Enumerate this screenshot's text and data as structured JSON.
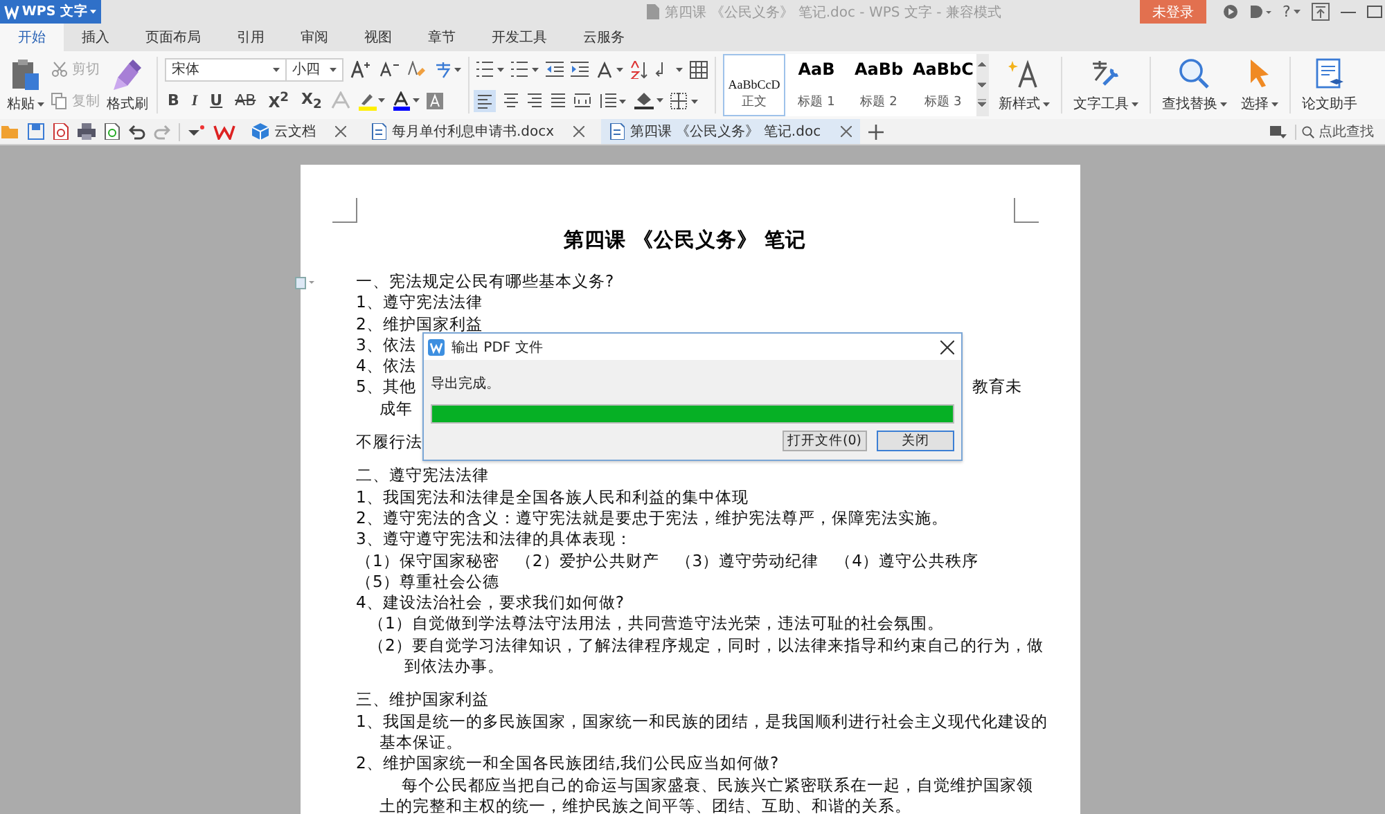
{
  "app_menu": {
    "label": "WPS 文字"
  },
  "window": {
    "title": "第四课 《公民义务》 笔记.doc - WPS 文字 - 兼容模式"
  },
  "login_button": {
    "label": "未登录"
  },
  "help_button": {
    "label": "?"
  },
  "ribbon_tabs": [
    {
      "label": "开始",
      "selected": true
    },
    {
      "label": "插入",
      "selected": false
    },
    {
      "label": "页面布局",
      "selected": false
    },
    {
      "label": "引用",
      "selected": false
    },
    {
      "label": "审阅",
      "selected": false
    },
    {
      "label": "视图",
      "selected": false
    },
    {
      "label": "章节",
      "selected": false
    },
    {
      "label": "开发工具",
      "selected": false
    },
    {
      "label": "云服务",
      "selected": false
    }
  ],
  "ribbon": {
    "paste": {
      "label": "粘贴"
    },
    "cut": {
      "label": "剪切",
      "disabled": true
    },
    "copy": {
      "label": "复制",
      "disabled": true
    },
    "format_painter": {
      "label": "格式刷"
    },
    "font_name": {
      "value": "宋体"
    },
    "font_size": {
      "value": "小四"
    },
    "format_buttons": [
      {
        "label": "B",
        "kind": "bold"
      },
      {
        "label": "I",
        "kind": "italic"
      },
      {
        "label": "U",
        "kind": "underline"
      },
      {
        "label": "AB",
        "kind": "strike"
      },
      {
        "label": "X$^{2}$",
        "kind": "script"
      },
      {
        "label": "X$_{2}$",
        "kind": "script"
      }
    ],
    "styles": [
      {
        "preview": "AaBbCcD",
        "label": "正文",
        "selected": true,
        "kind": "body"
      },
      {
        "preview": "AaB",
        "label": "标题 1",
        "selected": false,
        "kind": "heading"
      },
      {
        "preview": "AaBb",
        "label": "标题 2",
        "selected": false,
        "kind": "heading"
      },
      {
        "preview": "AaBbC",
        "label": "标题 3",
        "selected": false,
        "kind": "heading"
      }
    ],
    "tools": [
      {
        "label": "新样式",
        "kind": "new-style"
      },
      {
        "label": "文字工具",
        "kind": "text-tools"
      },
      {
        "label": "查找替换",
        "kind": "find"
      },
      {
        "label": "选择",
        "kind": "select"
      },
      {
        "label": "论文助手",
        "kind": "paper"
      }
    ]
  },
  "doc_tabs": [
    {
      "label": "云文档",
      "kind": "cloud",
      "selected": false
    },
    {
      "label": "每月单付利息申请书.docx",
      "kind": "doc",
      "selected": false
    },
    {
      "label": "第四课 《公民义务》 笔记.doc",
      "kind": "doc",
      "selected": true
    }
  ],
  "search": {
    "placeholder": "点此查找"
  },
  "document": {
    "title": "第四课 《公民义务》 笔记",
    "sections": [
      {
        "lines": [
          {
            "text": "一、宪法规定公民有哪些基本义务?",
            "kind": "line"
          },
          {
            "text": "1、遵守宪法法律",
            "kind": "line"
          },
          {
            "text": "2、维护国家利益",
            "kind": "line"
          },
          {
            "text": "3、依法",
            "kind": "line"
          },
          {
            "text": "4、依法",
            "kind": "line"
          },
          {
            "text": "5、其他",
            "tail": "教育未",
            "kind": "line"
          },
          {
            "text": "成年",
            "kind": "wrap"
          }
        ]
      },
      {
        "lines": [
          {
            "text": "不履行法",
            "kind": "line"
          }
        ]
      },
      {
        "lines": [
          {
            "text": "二、遵守宪法法律",
            "kind": "line"
          },
          {
            "text": "1、我国宪法和法律是全国各族人民和利益的集中体现",
            "kind": "line"
          },
          {
            "text": "2、遵守宪法的含义：遵守宪法就是要忠于宪法，维护宪法尊严，保障宪法实施。",
            "kind": "line"
          },
          {
            "text": "3、遵守遵守宪法和法律的具体表现：",
            "kind": "line"
          },
          {
            "text": "（1）保守国家秘密　（2）爱护公共财产　（3）遵守劳动纪律　（4）遵守公共秩序",
            "kind": "line"
          },
          {
            "text": "（5）尊重社会公德",
            "kind": "line"
          },
          {
            "text": "4、建设法治社会，要求我们如何做?",
            "kind": "line"
          },
          {
            "text": "（1）自觉做到学法尊法守法用法，共同营造守法光荣，违法可耻的社会氛围。",
            "kind": "sub"
          },
          {
            "text": "（2）要自觉学习法律知识，了解法律程序规定，同时，以法律来指导和约束自己的行为，做",
            "kind": "sub"
          },
          {
            "text": "到依法办事。",
            "kind": "subwrap"
          }
        ]
      },
      {
        "lines": [
          {
            "text": "三、维护国家利益",
            "kind": "line"
          },
          {
            "text": "1、我国是统一的多民族国家，国家统一和民族的团结，是我国顺利进行社会主义现代化建设的",
            "kind": "line"
          },
          {
            "text": "基本保证。",
            "kind": "wrap"
          },
          {
            "text": "2、维护国家统一和全国各民族团结,我们公民应当如何做?",
            "kind": "line"
          },
          {
            "text": "每个公民都应当把自己的命运与国家盛衰、民族兴亡紧密联系在一起，自觉维护国家领",
            "kind": "indent"
          },
          {
            "text": "土的完整和主权的统一，维护民族之间平等、团结、互助、和谐的关系。",
            "kind": "wrap"
          }
        ]
      }
    ]
  },
  "dialog": {
    "title": "输出 PDF 文件",
    "message": "导出完成。",
    "level": 1,
    "buttons": [
      {
        "label": "打开文件(0)",
        "kind": "secondary"
      },
      {
        "label": "关闭",
        "kind": "default"
      }
    ]
  }
}
